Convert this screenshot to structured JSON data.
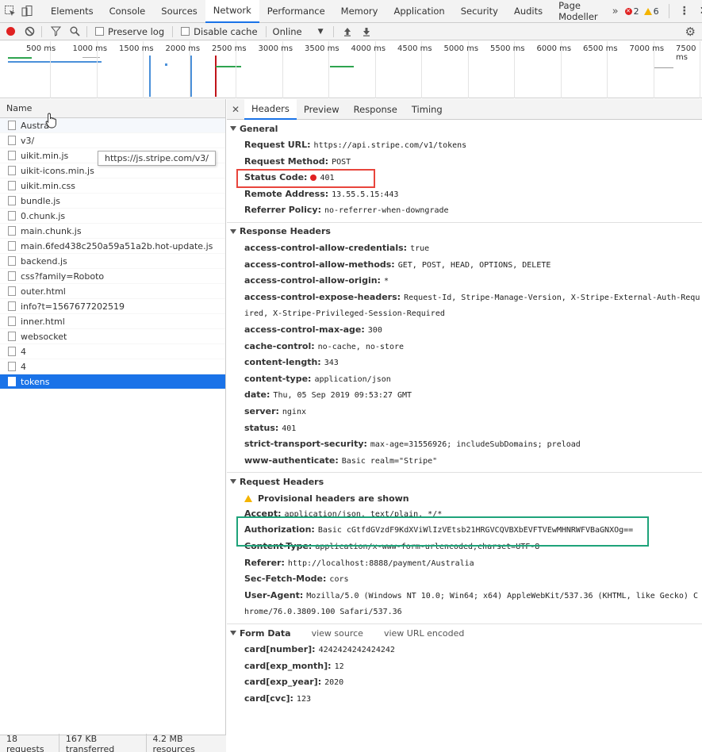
{
  "devtools_tabs": [
    "Elements",
    "Console",
    "Sources",
    "Network",
    "Performance",
    "Memory",
    "Application",
    "Security",
    "Audits",
    "Page Modeller"
  ],
  "active_tab": "Network",
  "more_tabs_icon": "chevron-double-right",
  "error_count": "2",
  "warning_count": "6",
  "toolbar": {
    "preserve_log": "Preserve log",
    "disable_cache": "Disable cache",
    "throttle": "Online"
  },
  "overview_ticks": [
    "500 ms",
    "1000 ms",
    "1500 ms",
    "2000 ms",
    "2500 ms",
    "3000 ms",
    "3500 ms",
    "4000 ms",
    "4500 ms",
    "5000 ms",
    "5500 ms",
    "6000 ms",
    "6500 ms",
    "7000 ms",
    "7500 ms"
  ],
  "requests_header": "Name",
  "requests": [
    "Austra",
    "v3/",
    "uikit.min.js",
    "uikit-icons.min.js",
    "uikit.min.css",
    "bundle.js",
    "0.chunk.js",
    "main.chunk.js",
    "main.6fed438c250a59a51a2b.hot-update.js",
    "backend.js",
    "css?family=Roboto",
    "outer.html",
    "info?t=1567677202519",
    "inner.html",
    "websocket",
    "4",
    "4",
    "tokens"
  ],
  "selected_request": "tokens",
  "tooltip": "https://js.stripe.com/v3/",
  "status": {
    "requests": "18 requests",
    "transferred": "167 KB transferred",
    "resources": "4.2 MB resources"
  },
  "detail_tabs": [
    "Headers",
    "Preview",
    "Response",
    "Timing"
  ],
  "active_detail_tab": "Headers",
  "general": {
    "title": "General",
    "rows": [
      {
        "k": "Request URL:",
        "v": "https://api.stripe.com/v1/tokens"
      },
      {
        "k": "Request Method:",
        "v": "POST"
      },
      {
        "k": "Status Code:",
        "v": "401"
      },
      {
        "k": "Remote Address:",
        "v": "13.55.5.15:443"
      },
      {
        "k": "Referrer Policy:",
        "v": "no-referrer-when-downgrade"
      }
    ]
  },
  "response_headers": {
    "title": "Response Headers",
    "rows": [
      {
        "k": "access-control-allow-credentials:",
        "v": "true"
      },
      {
        "k": "access-control-allow-methods:",
        "v": "GET, POST, HEAD, OPTIONS, DELETE"
      },
      {
        "k": "access-control-allow-origin:",
        "v": "*"
      },
      {
        "k": "access-control-expose-headers:",
        "v": "Request-Id, Stripe-Manage-Version, X-Stripe-External-Auth-Required, X-Stripe-Privileged-Session-Required"
      },
      {
        "k": "access-control-max-age:",
        "v": "300"
      },
      {
        "k": "cache-control:",
        "v": "no-cache, no-store"
      },
      {
        "k": "content-length:",
        "v": "343"
      },
      {
        "k": "content-type:",
        "v": "application/json"
      },
      {
        "k": "date:",
        "v": "Thu, 05 Sep 2019 09:53:27 GMT"
      },
      {
        "k": "server:",
        "v": "nginx"
      },
      {
        "k": "status:",
        "v": "401"
      },
      {
        "k": "strict-transport-security:",
        "v": "max-age=31556926; includeSubDomains; preload"
      },
      {
        "k": "www-authenticate:",
        "v": "Basic realm=\"Stripe\""
      }
    ]
  },
  "request_headers": {
    "title": "Request Headers",
    "provisional": "Provisional headers are shown",
    "rows": [
      {
        "k": "Accept:",
        "v": "application/json, text/plain, */*"
      },
      {
        "k": "Authorization:",
        "v": "Basic cGtfdGVzdF9KdXViWlIzVEtsb21HRGVCQVBXbEVFTVEwMHNRWFVBaGNXOg=="
      },
      {
        "k": "Content-Type:",
        "v": "application/x-www-form-urlencoded;charset=UTF-8"
      },
      {
        "k": "Referer:",
        "v": "http://localhost:8888/payment/Australia"
      },
      {
        "k": "Sec-Fetch-Mode:",
        "v": "cors"
      },
      {
        "k": "User-Agent:",
        "v": "Mozilla/5.0 (Windows NT 10.0; Win64; x64) AppleWebKit/537.36 (KHTML, like Gecko) Chrome/76.0.3809.100 Safari/537.36"
      }
    ]
  },
  "form_data": {
    "title": "Form Data",
    "view_source": "view source",
    "view_url_encoded": "view URL encoded",
    "rows": [
      {
        "k": "card[number]:",
        "v": "4242424242424242"
      },
      {
        "k": "card[exp_month]:",
        "v": "12"
      },
      {
        "k": "card[exp_year]:",
        "v": "2020"
      },
      {
        "k": "card[cvc]:",
        "v": "123"
      }
    ]
  },
  "colors": {
    "accent": "#1a73e8",
    "error": "#e02222",
    "highlight_red": "#e8453c",
    "highlight_green": "#1ea37a"
  }
}
